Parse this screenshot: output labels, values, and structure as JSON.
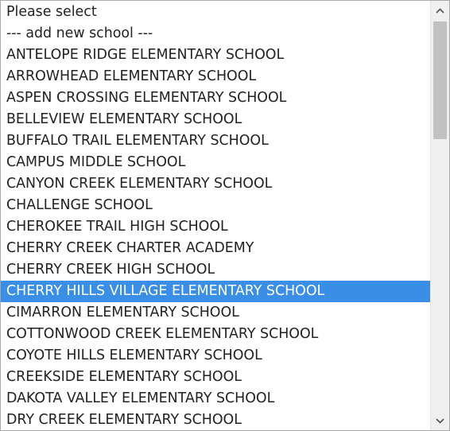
{
  "select": {
    "selected_index": 13,
    "options": [
      "Please select",
      "--- add new school ---",
      "ANTELOPE RIDGE ELEMENTARY SCHOOL",
      "ARROWHEAD ELEMENTARY SCHOOL",
      "ASPEN CROSSING ELEMENTARY SCHOOL",
      "BELLEVIEW ELEMENTARY SCHOOL",
      "BUFFALO TRAIL ELEMENTARY SCHOOL",
      "CAMPUS MIDDLE SCHOOL",
      "CANYON CREEK ELEMENTARY SCHOOL",
      "CHALLENGE SCHOOL",
      "CHEROKEE TRAIL HIGH SCHOOL",
      "CHERRY CREEK CHARTER ACADEMY",
      "CHERRY CREEK HIGH SCHOOL",
      "CHERRY HILLS VILLAGE ELEMENTARY SCHOOL",
      "CIMARRON ELEMENTARY SCHOOL",
      "COTTONWOOD CREEK ELEMENTARY SCHOOL",
      "COYOTE HILLS ELEMENTARY SCHOOL",
      "CREEKSIDE ELEMENTARY SCHOOL",
      "DAKOTA VALLEY ELEMENTARY SCHOOL",
      "DRY CREEK ELEMENTARY SCHOOL"
    ]
  },
  "scrollbar": {
    "position_fraction": 0.0,
    "up_icon": "chevron-up-icon",
    "down_icon": "chevron-down-icon"
  },
  "colors": {
    "selected_bg": "#3a8ee6",
    "selected_text": "#ffffff",
    "text": "#222222",
    "border": "#a9a9a9",
    "scroll_track": "#f0f0f0",
    "scroll_thumb": "#c1c1c1"
  }
}
